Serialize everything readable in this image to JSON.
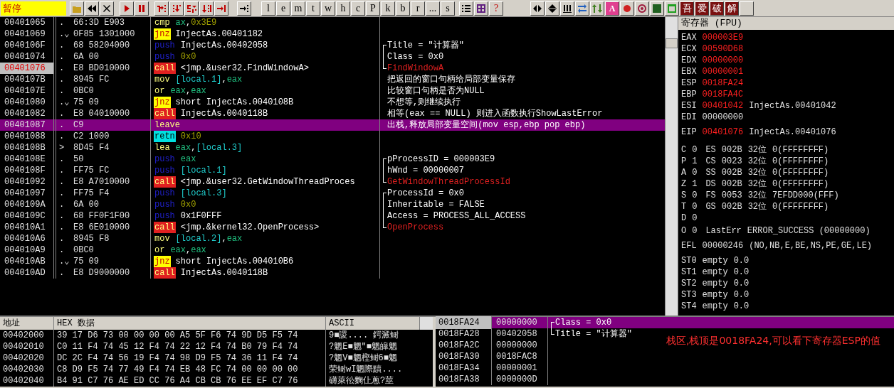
{
  "toolbar": {
    "status": "暂停",
    "letters": [
      "l",
      "e",
      "m",
      "t",
      "w",
      "h",
      "c",
      "P",
      "k",
      "b",
      "r",
      "...",
      "s"
    ],
    "plugins": [
      "吾",
      "爱",
      "破",
      "解"
    ],
    "help": "?",
    "letter_button": "A"
  },
  "disasm": {
    "rows": [
      {
        "address": "00401065",
        "mark": ".",
        "hex": "66:3D E903",
        "mnemonic": "cmp",
        "kind": "plain",
        "operands": [
          {
            "text": "ax",
            "kind": "reg"
          },
          {
            "text": ",",
            "kind": "plain"
          },
          {
            "text": "0x3E9",
            "kind": "const"
          }
        ],
        "selected": false,
        "eip": false
      },
      {
        "address": "00401069",
        "mark": ".⌄",
        "hex": "0F85 1301000",
        "mnemonic": "jnz",
        "kind": "jump",
        "operands": [
          {
            "text": "InjectAs.00401182",
            "kind": "plain"
          }
        ],
        "selected": false,
        "eip": false
      },
      {
        "address": "0040106F",
        "mark": ".",
        "hex": "68 58204000",
        "mnemonic": "push",
        "kind": "push",
        "operands": [
          {
            "text": "InjectAs.00402058",
            "kind": "plain"
          }
        ],
        "selected": false,
        "eip": false,
        "comment": {
          "text": "Title = \"计算器\"",
          "kind": "start",
          "is_function": false
        }
      },
      {
        "address": "00401074",
        "mark": ".",
        "hex": "6A 00",
        "mnemonic": "push",
        "kind": "push",
        "operands": [
          {
            "text": "0x0",
            "kind": "const"
          }
        ],
        "selected": false,
        "eip": false,
        "comment": {
          "text": "Class = 0x0",
          "kind": "mid",
          "is_function": false
        }
      },
      {
        "address": "00401076",
        "mark": ".",
        "hex": "E8 BD010000",
        "mnemonic": "call",
        "kind": "call",
        "operands": [
          {
            "text": "<jmp.&user32.FindWindowA>",
            "kind": "plain"
          }
        ],
        "selected": false,
        "eip": true,
        "comment": {
          "text": "FindWindowA",
          "kind": "end",
          "is_function": true
        }
      },
      {
        "address": "0040107B",
        "mark": ".",
        "hex": "8945 FC",
        "mnemonic": "mov",
        "kind": "plain",
        "operands": [
          {
            "text": "[local.1]",
            "kind": "mem"
          },
          {
            "text": ",",
            "kind": "plain"
          },
          {
            "text": "eax",
            "kind": "reg"
          }
        ],
        "selected": false,
        "eip": false,
        "comment": {
          "text": "把返回的窗口句柄给局部变量保存",
          "kind": "plain",
          "is_function": false
        }
      },
      {
        "address": "0040107E",
        "mark": ".",
        "hex": "0BC0",
        "mnemonic": "or",
        "kind": "plain",
        "operands": [
          {
            "text": "eax",
            "kind": "reg"
          },
          {
            "text": ",",
            "kind": "plain"
          },
          {
            "text": "eax",
            "kind": "reg"
          }
        ],
        "selected": false,
        "eip": false,
        "comment": {
          "text": "比较窗口句柄是否为NULL",
          "kind": "plain",
          "is_function": false
        }
      },
      {
        "address": "00401080",
        "mark": ".⌄",
        "hex": "75 09",
        "mnemonic": "jnz",
        "kind": "jump",
        "operands": [
          {
            "text": "short InjectAs.0040108B",
            "kind": "plain"
          }
        ],
        "selected": false,
        "eip": false,
        "comment": {
          "text": "不想等,则继续执行",
          "kind": "plain",
          "is_function": false
        }
      },
      {
        "address": "00401082",
        "mark": ".",
        "hex": "E8 04010000",
        "mnemonic": "call",
        "kind": "call",
        "operands": [
          {
            "text": "InjectAs.0040118B",
            "kind": "plain"
          }
        ],
        "selected": false,
        "eip": false,
        "comment": {
          "text": "相等(eax == NULL) 则进入函数执行ShowLastError",
          "kind": "plain",
          "is_function": false
        }
      },
      {
        "address": "00401087",
        "mark": ".",
        "hex": "C9",
        "mnemonic": "leave",
        "kind": "plain",
        "operands": [],
        "selected": true,
        "eip": false,
        "comment": {
          "text": "出栈,释放局部变量空间(mov esp,ebp pop ebp)",
          "kind": "plain",
          "is_function": false
        }
      },
      {
        "address": "00401088",
        "mark": ".",
        "hex": "C2 1000",
        "mnemonic": "retn",
        "kind": "return",
        "operands": [
          {
            "text": "0x10",
            "kind": "const"
          }
        ],
        "selected": false,
        "eip": false
      },
      {
        "address": "0040108B",
        "mark": ">",
        "hex": "8D45 F4",
        "mnemonic": "lea",
        "kind": "plain",
        "operands": [
          {
            "text": "eax",
            "kind": "reg"
          },
          {
            "text": ",",
            "kind": "plain"
          },
          {
            "text": "[local.3]",
            "kind": "mem"
          }
        ],
        "selected": false,
        "eip": false
      },
      {
        "address": "0040108E",
        "mark": ".",
        "hex": "50",
        "mnemonic": "push",
        "kind": "push",
        "operands": [
          {
            "text": "eax",
            "kind": "reg"
          }
        ],
        "selected": false,
        "eip": false,
        "comment": {
          "text": "pProcessID = 000003E9",
          "kind": "start",
          "is_function": false
        }
      },
      {
        "address": "0040108F",
        "mark": ".",
        "hex": "FF75 FC",
        "mnemonic": "push",
        "kind": "push",
        "operands": [
          {
            "text": "[local.1]",
            "kind": "mem"
          }
        ],
        "selected": false,
        "eip": false,
        "comment": {
          "text": "hWnd = 00000007",
          "kind": "mid",
          "is_function": false
        }
      },
      {
        "address": "00401092",
        "mark": ".",
        "hex": "E8 A7010000",
        "mnemonic": "call",
        "kind": "call",
        "operands": [
          {
            "text": "<jmp.&user32.GetWindowThreadProces",
            "kind": "plain"
          }
        ],
        "selected": false,
        "eip": false,
        "comment": {
          "text": "GetWindowThreadProcessId",
          "kind": "end",
          "is_function": true
        }
      },
      {
        "address": "00401097",
        "mark": ".",
        "hex": "FF75 F4",
        "mnemonic": "push",
        "kind": "push",
        "operands": [
          {
            "text": "[local.3]",
            "kind": "mem"
          }
        ],
        "selected": false,
        "eip": false,
        "comment": {
          "text": "ProcessId = 0x0",
          "kind": "start",
          "is_function": false
        }
      },
      {
        "address": "0040109A",
        "mark": ".",
        "hex": "6A 00",
        "mnemonic": "push",
        "kind": "push",
        "operands": [
          {
            "text": "0x0",
            "kind": "const"
          }
        ],
        "selected": false,
        "eip": false,
        "comment": {
          "text": "Inheritable = FALSE",
          "kind": "mid",
          "is_function": false
        }
      },
      {
        "address": "0040109C",
        "mark": ".",
        "hex": "68 FF0F1F00",
        "mnemonic": "push",
        "kind": "push",
        "operands": [
          {
            "text": "0x1F0FFF",
            "kind": "plain"
          }
        ],
        "selected": false,
        "eip": false,
        "comment": {
          "text": "Access = PROCESS_ALL_ACCESS",
          "kind": "mid",
          "is_function": false
        }
      },
      {
        "address": "004010A1",
        "mark": ".",
        "hex": "E8 6E010000",
        "mnemonic": "call",
        "kind": "call",
        "operands": [
          {
            "text": "<jmp.&kernel32.OpenProcess>",
            "kind": "plain"
          }
        ],
        "selected": false,
        "eip": false,
        "comment": {
          "text": "OpenProcess",
          "kind": "end",
          "is_function": true
        }
      },
      {
        "address": "004010A6",
        "mark": ".",
        "hex": "8945 F8",
        "mnemonic": "mov",
        "kind": "plain",
        "operands": [
          {
            "text": "[local.2]",
            "kind": "mem"
          },
          {
            "text": ",",
            "kind": "plain"
          },
          {
            "text": "eax",
            "kind": "reg"
          }
        ],
        "selected": false,
        "eip": false
      },
      {
        "address": "004010A9",
        "mark": ".",
        "hex": "0BC0",
        "mnemonic": "or",
        "kind": "plain",
        "operands": [
          {
            "text": "eax",
            "kind": "reg"
          },
          {
            "text": ",",
            "kind": "plain"
          },
          {
            "text": "eax",
            "kind": "reg"
          }
        ],
        "selected": false,
        "eip": false
      },
      {
        "address": "004010AB",
        "mark": ".⌄",
        "hex": "75 09",
        "mnemonic": "jnz",
        "kind": "jump",
        "operands": [
          {
            "text": "short InjectAs.004010B6",
            "kind": "plain"
          }
        ],
        "selected": false,
        "eip": false
      },
      {
        "address": "004010AD",
        "mark": ".",
        "hex": "E8 D9000000",
        "mnemonic": "call",
        "kind": "call",
        "operands": [
          {
            "text": "InjectAs.0040118B",
            "kind": "plain"
          }
        ],
        "selected": false,
        "eip": false
      }
    ]
  },
  "registers": {
    "title": "寄存器 (FPU)",
    "general": [
      {
        "name": "EAX",
        "value": "000003E9",
        "changed": true
      },
      {
        "name": "ECX",
        "value": "00590D68",
        "changed": true
      },
      {
        "name": "EDX",
        "value": "00000000",
        "changed": true
      },
      {
        "name": "EBX",
        "value": "00000001",
        "changed": true
      },
      {
        "name": "ESP",
        "value": "0018FA24",
        "changed": true
      },
      {
        "name": "EBP",
        "value": "0018FA4C",
        "changed": true
      },
      {
        "name": "ESI",
        "value": "00401042",
        "changed": true,
        "symbol": "InjectAs.00401042"
      },
      {
        "name": "EDI",
        "value": "00000000",
        "changed": false
      }
    ],
    "eip": {
      "name": "EIP",
      "value": "00401076",
      "changed": true,
      "symbol": "InjectAs.00401076"
    },
    "flags": [
      {
        "kind": "segment",
        "flag": "C",
        "value": "0",
        "segment": "ES",
        "selector": "002B",
        "bits": "32位",
        "base": "0(FFFFFFFF)"
      },
      {
        "kind": "segment",
        "flag": "P",
        "value": "1",
        "segment": "CS",
        "selector": "0023",
        "bits": "32位",
        "base": "0(FFFFFFFF)"
      },
      {
        "kind": "segment",
        "flag": "A",
        "value": "0",
        "segment": "SS",
        "selector": "002B",
        "bits": "32位",
        "base": "0(FFFFFFFF)"
      },
      {
        "kind": "segment",
        "flag": "Z",
        "value": "1",
        "segment": "DS",
        "selector": "002B",
        "bits": "32位",
        "base": "0(FFFFFFFF)"
      },
      {
        "kind": "segment",
        "flag": "S",
        "value": "0",
        "segment": "FS",
        "selector": "0053",
        "bits": "32位",
        "base": "7EFDD000(FFF)"
      },
      {
        "kind": "segment",
        "flag": "T",
        "value": "0",
        "segment": "GS",
        "selector": "002B",
        "bits": "32位",
        "base": "0(FFFFFFFF)"
      },
      {
        "kind": "plain",
        "flag": "D",
        "value": "0"
      },
      {
        "kind": "lasterr",
        "flag": "O",
        "value": "0",
        "label": "LastErr",
        "detail": "ERROR_SUCCESS (00000000)"
      }
    ],
    "efl": {
      "name": "EFL",
      "value": "00000246",
      "detail": "(NO,NB,E,BE,NS,PE,GE,LE)"
    },
    "fpu": [
      {
        "name": "ST0",
        "tag": "empty",
        "value": "0.0"
      },
      {
        "name": "ST1",
        "tag": "empty",
        "value": "0.0"
      },
      {
        "name": "ST2",
        "tag": "empty",
        "value": "0.0"
      },
      {
        "name": "ST3",
        "tag": "empty",
        "value": "0.0"
      },
      {
        "name": "ST4",
        "tag": "empty",
        "value": "0.0"
      }
    ]
  },
  "dump": {
    "columns": [
      "地址",
      "HEX 数据",
      "ASCII"
    ],
    "rows": [
      {
        "address": "00402000",
        "hex": "39 17 D6 73 00 00 00 00 A5 5F F6 74 9D D5 F5 74",
        "ascii": "9■謖....  鍔澱鲥"
      },
      {
        "address": "00402010",
        "hex": "C0 11 F4 74 45 12 F4 74 22 12 F4 74 B0 79 F4 74",
        "ascii": "?魍E■魍\"■魍皡魍"
      },
      {
        "address": "00402020",
        "hex": "DC 2C F4 74 56 19 F4 74 98 D9 F5 74 36 11 F4 74",
        "ascii": "?魍V■魍樫鲥6■魍"
      },
      {
        "address": "00402030",
        "hex": "C8 D9 F5 74 77 49 F4 74 EB 48 FC 74 00 00 00 00",
        "ascii": "荣鲥wI魍際黷...."
      },
      {
        "address": "00402040",
        "hex": "B4 91 C7 76 AE ED CC 76 A4 CB CB 76 EE EF C7 76",
        "ascii": "礴萊彸麴仩蔥?莁"
      }
    ]
  },
  "stack": {
    "rows": [
      {
        "address": "0018FA24",
        "value": "00000000",
        "selected": true,
        "comment": {
          "text": "Class = 0x0",
          "kind": "start"
        }
      },
      {
        "address": "0018FA28",
        "value": "00402058",
        "selected": false,
        "comment": {
          "text": "Title = \"计算器\"",
          "kind": "end"
        }
      },
      {
        "address": "0018FA2C",
        "value": "00000000",
        "selected": false
      },
      {
        "address": "0018FA30",
        "value": "0018FAC8",
        "selected": false
      },
      {
        "address": "0018FA34",
        "value": "00000001",
        "selected": false
      },
      {
        "address": "0018FA38",
        "value": "0000000D",
        "selected": false
      }
    ],
    "note": "栈区,栈顶是0018FA24,可以看下寄存器ESP的值"
  }
}
